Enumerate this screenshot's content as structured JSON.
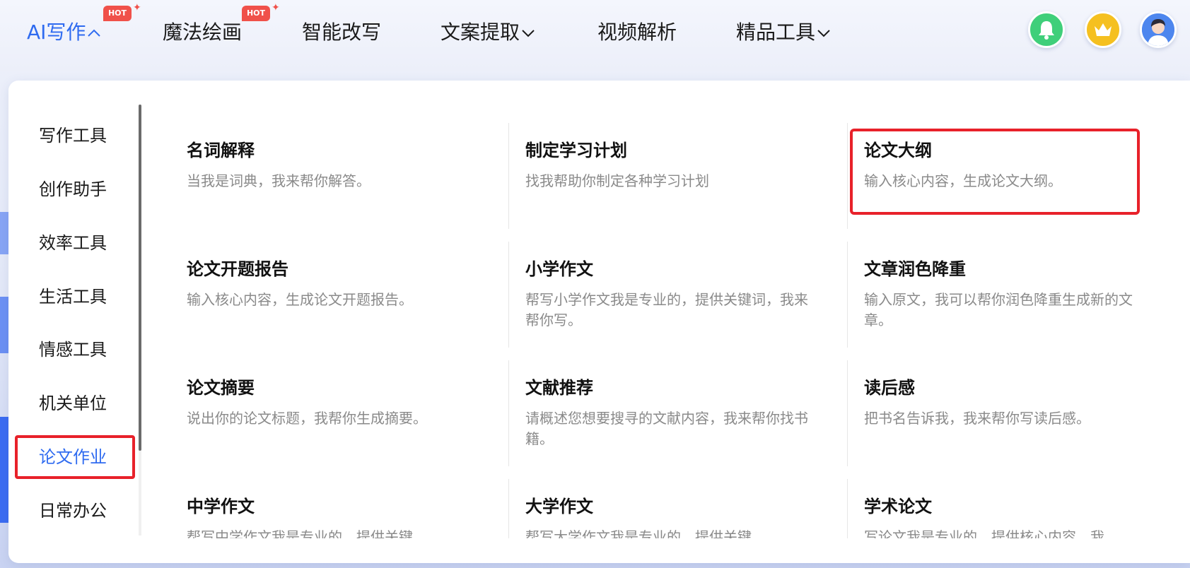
{
  "nav": {
    "items": [
      {
        "label": "AI写作",
        "hot": true,
        "caret": "up"
      },
      {
        "label": "魔法绘画",
        "hot": true,
        "caret": ""
      },
      {
        "label": "智能改写",
        "hot": false,
        "caret": ""
      },
      {
        "label": "文案提取",
        "hot": false,
        "caret": "down"
      },
      {
        "label": "视频解析",
        "hot": false,
        "caret": ""
      },
      {
        "label": "精品工具",
        "hot": false,
        "caret": "down"
      }
    ],
    "hot_badge": "HOT",
    "icons": {
      "bell": "bell-icon",
      "crown": "crown-icon",
      "avatar": "avatar-icon"
    },
    "colors": {
      "active": "#2f6bf0",
      "hot": "#f0514a",
      "bell_bg": "#3fcf7a",
      "crown_bg": "#f5c020",
      "avatar_bg": "#4d86ee"
    }
  },
  "sidebar": {
    "items": [
      {
        "label": "写作工具"
      },
      {
        "label": "创作助手"
      },
      {
        "label": "效率工具"
      },
      {
        "label": "生活工具"
      },
      {
        "label": "情感工具"
      },
      {
        "label": "机关单位"
      },
      {
        "label": "论文作业",
        "active": true
      },
      {
        "label": "日常办公"
      }
    ]
  },
  "tools": [
    {
      "title": "名词解释",
      "desc": "当我是词典，我来帮你解答。"
    },
    {
      "title": "制定学习计划",
      "desc": "找我帮助你制定各种学习计划"
    },
    {
      "title": "论文大纲",
      "desc": "输入核心内容，生成论文大纲。",
      "highlighted": true
    },
    {
      "title": "论文开题报告",
      "desc": "输入核心内容，生成论文开题报告。"
    },
    {
      "title": "小学作文",
      "desc": "帮写小学作文我是专业的，提供关键词，我来帮你写。"
    },
    {
      "title": "文章润色降重",
      "desc": "输入原文，我可以帮你润色降重生成新的文章。"
    },
    {
      "title": "论文摘要",
      "desc": "说出你的论文标题，我帮你生成摘要。"
    },
    {
      "title": "文献推荐",
      "desc": "请概述您想要搜寻的文献内容，我来帮你找书籍。"
    },
    {
      "title": "读后感",
      "desc": "把书名告诉我，我来帮你写读后感。"
    },
    {
      "title": "中学作文",
      "desc": "帮写中学作文我是专业的，提供关键"
    },
    {
      "title": "大学作文",
      "desc": "帮写大学作文我是专业的，提供关键"
    },
    {
      "title": "学术论文",
      "desc": "写论文我是专业的，提供核心内容，我"
    }
  ],
  "highlight_color": "#e8212a"
}
